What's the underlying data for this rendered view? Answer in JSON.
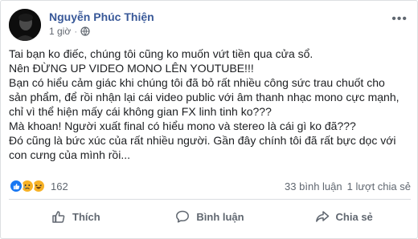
{
  "post": {
    "author": "Nguyễn Phúc Thiện",
    "timestamp": "1 giờ",
    "separator": "·",
    "more_icon": "more-options-icon",
    "lines": [
      "Tai bạn ko điếc, chúng tôi cũng ko muốn vứt tiền qua cửa sổ.",
      "Nên ĐỪNG UP VIDEO MONO LÊN YOUTUBE!!!",
      "Bạn có hiểu cảm giác khi chúng tôi đã bỏ rất nhiều công sức trau chuốt cho",
      "sản phẩm, để rồi nhận lại cái video public với âm thanh nhạc mono cực mạnh,",
      "chỉ vì thể hiện mấy cái không gian FX linh tinh ko???",
      "Mà khoan! Người xuất final có hiểu mono và stereo là cái gì ko đã???",
      "Đó cũng là bức xúc của rất nhiều người. Gần đây chính tôi đã rất bực dọc với",
      "con cưng của mình rồi..."
    ]
  },
  "stats": {
    "reaction_count": "162",
    "comments": "33 bình luận",
    "shares": "1 lượt chia sẻ"
  },
  "actions": {
    "like": "Thích",
    "comment": "Bình luận",
    "share": "Chia sẻ"
  },
  "colors": {
    "author": "#385898",
    "like_blue": "#1877f2",
    "emoji_yellow": "#f7b125",
    "secondary_text": "#606770"
  }
}
